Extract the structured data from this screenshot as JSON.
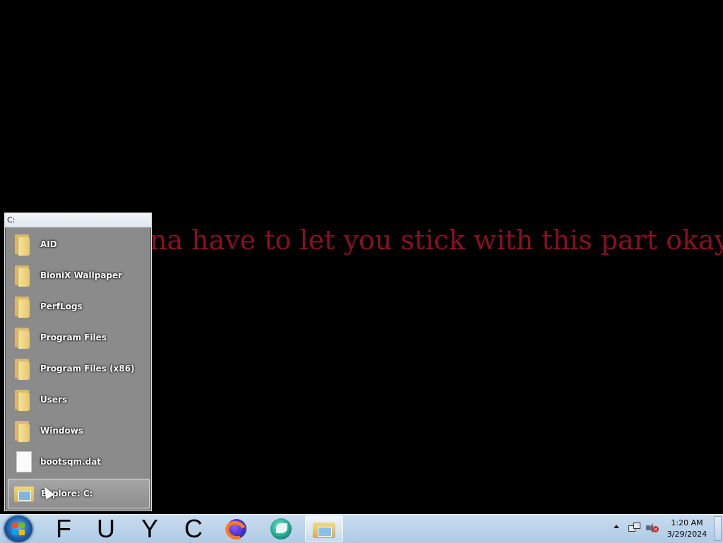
{
  "desktop": {
    "wallpaper_text": "na have to let you stick with this part okay?"
  },
  "folder_menu": {
    "header": "C:",
    "items": [
      {
        "label": "AID",
        "icon": "folder-icon"
      },
      {
        "label": "BioniX Wallpaper",
        "icon": "folder-icon"
      },
      {
        "label": "PerfLogs",
        "icon": "folder-icon"
      },
      {
        "label": "Program Files",
        "icon": "folder-icon"
      },
      {
        "label": "Program Files (x86)",
        "icon": "folder-icon"
      },
      {
        "label": "Users",
        "icon": "folder-icon"
      },
      {
        "label": "Windows",
        "icon": "folder-icon"
      },
      {
        "label": "bootsqm.dat",
        "icon": "file-icon"
      }
    ],
    "explore_label": "Explore: C:"
  },
  "taskbar": {
    "pinned_letters": [
      "F",
      "U",
      "Y",
      "C"
    ],
    "apps": [
      "firefox-icon",
      "bionix-icon",
      "windows-explorer-icon"
    ],
    "clock": {
      "time": "1:20 AM",
      "date": "3/29/2024"
    }
  },
  "colors": {
    "wallpaper_text": "#8a0f22",
    "taskbar": "#b6d0ea",
    "menu_background": "#8b8b8b"
  }
}
